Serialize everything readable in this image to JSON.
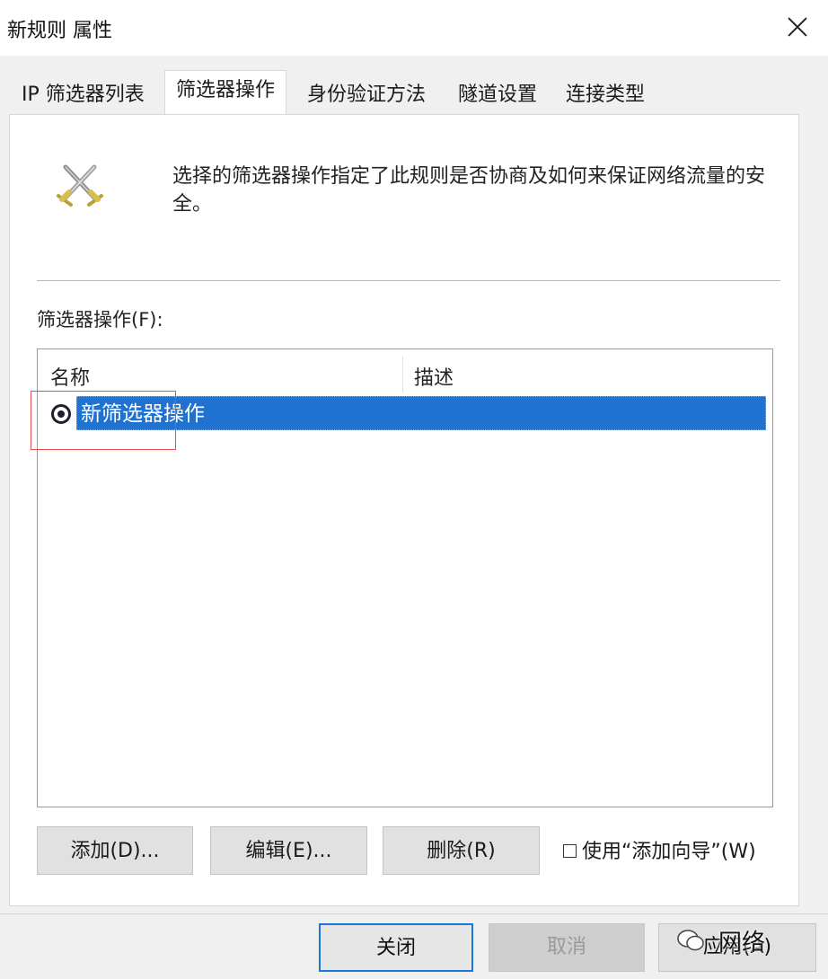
{
  "window": {
    "title": "新规则 属性"
  },
  "tabs": [
    {
      "label": "IP 筛选器列表"
    },
    {
      "label": "筛选器操作",
      "active": true
    },
    {
      "label": "身份验证方法"
    },
    {
      "label": "隧道设置"
    },
    {
      "label": "连接类型"
    }
  ],
  "panel": {
    "icon": "crossed-swords-icon",
    "description": "选择的筛选器操作指定了此规则是否协商及如何来保证网络流量的安全。",
    "list_label": "筛选器操作(F):",
    "columns": [
      "名称",
      "描述"
    ],
    "rows": [
      {
        "name": "新筛选器操作",
        "description": "",
        "selected": true,
        "radio_checked": true
      }
    ],
    "buttons": {
      "add": "添加(D)...",
      "edit": "编辑(E)...",
      "delete": "删除(R)"
    },
    "checkbox": {
      "label": "使用“添加向导”(W)",
      "checked": false
    }
  },
  "footer": {
    "close": "关闭",
    "cancel": "取消",
    "apply": "应用(A)"
  },
  "watermark": {
    "text": "网络",
    "icon": "wechat-icon"
  },
  "colors": {
    "selection": "#1f72d0",
    "focus_border": "#1b78d8",
    "annotation": "#ec4a4a"
  }
}
